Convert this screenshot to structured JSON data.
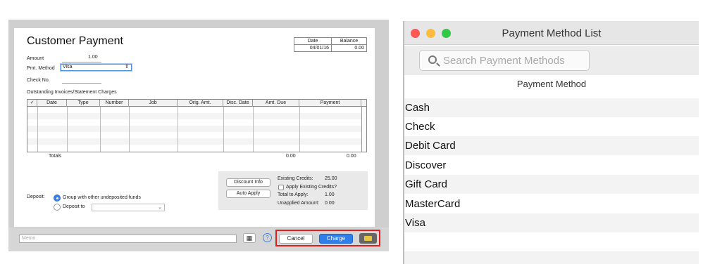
{
  "customer_payment": {
    "title": "Customer Payment",
    "date_header": "Date",
    "balance_header": "Balance",
    "date_value": "04/01/16",
    "balance_value": "0.00",
    "amount_label": "Amount",
    "amount_value": "1.00",
    "pmt_method_label": "Pmt. Method",
    "pmt_method_value": "Visa",
    "check_no_label": "Check No.",
    "outstanding_label": "Outstanding Invoices/Statement Charges",
    "columns": [
      "✓",
      "Date",
      "Type",
      "Number",
      "Job",
      "Orig. Amt.",
      "Disc. Date",
      "Amt. Due",
      "Payment"
    ],
    "totals_label": "Totals",
    "totals_amt_due": "0.00",
    "totals_payment": "0.00",
    "discount_info_button": "Discount Info",
    "auto_apply_button": "Auto Apply",
    "existing_credits_label": "Existing Credits:",
    "existing_credits_value": "25.00",
    "apply_existing_credits_label": "Apply Existing Credits?",
    "total_to_apply_label": "Total to Apply:",
    "total_to_apply_value": "1.00",
    "unapplied_label": "Unapplied Amount:",
    "unapplied_value": "0.00",
    "deposit_label": "Deposit:",
    "group_option": "Group with other undeposited funds",
    "deposit_to_option": "Deposit to",
    "memo_placeholder": "Memo",
    "help_label": "?",
    "cancel_button": "Cancel",
    "charge_button": "Charge",
    "calendar_icon": "calendar-icon",
    "card_icon": "credit-card-icon"
  },
  "payment_method_list": {
    "title": "Payment Method List",
    "search_placeholder": "Search Payment Methods",
    "column_header": "Payment Method",
    "items": [
      "Cash",
      "Check",
      "Debit Card",
      "Discover",
      "Gift Card",
      "MasterCard",
      "Visa"
    ]
  },
  "colors": {
    "close": "#fc5753",
    "minimize": "#fdbc40",
    "zoom": "#33c748",
    "accent": "#2f7ee9",
    "highlight": "#e01e1e"
  }
}
